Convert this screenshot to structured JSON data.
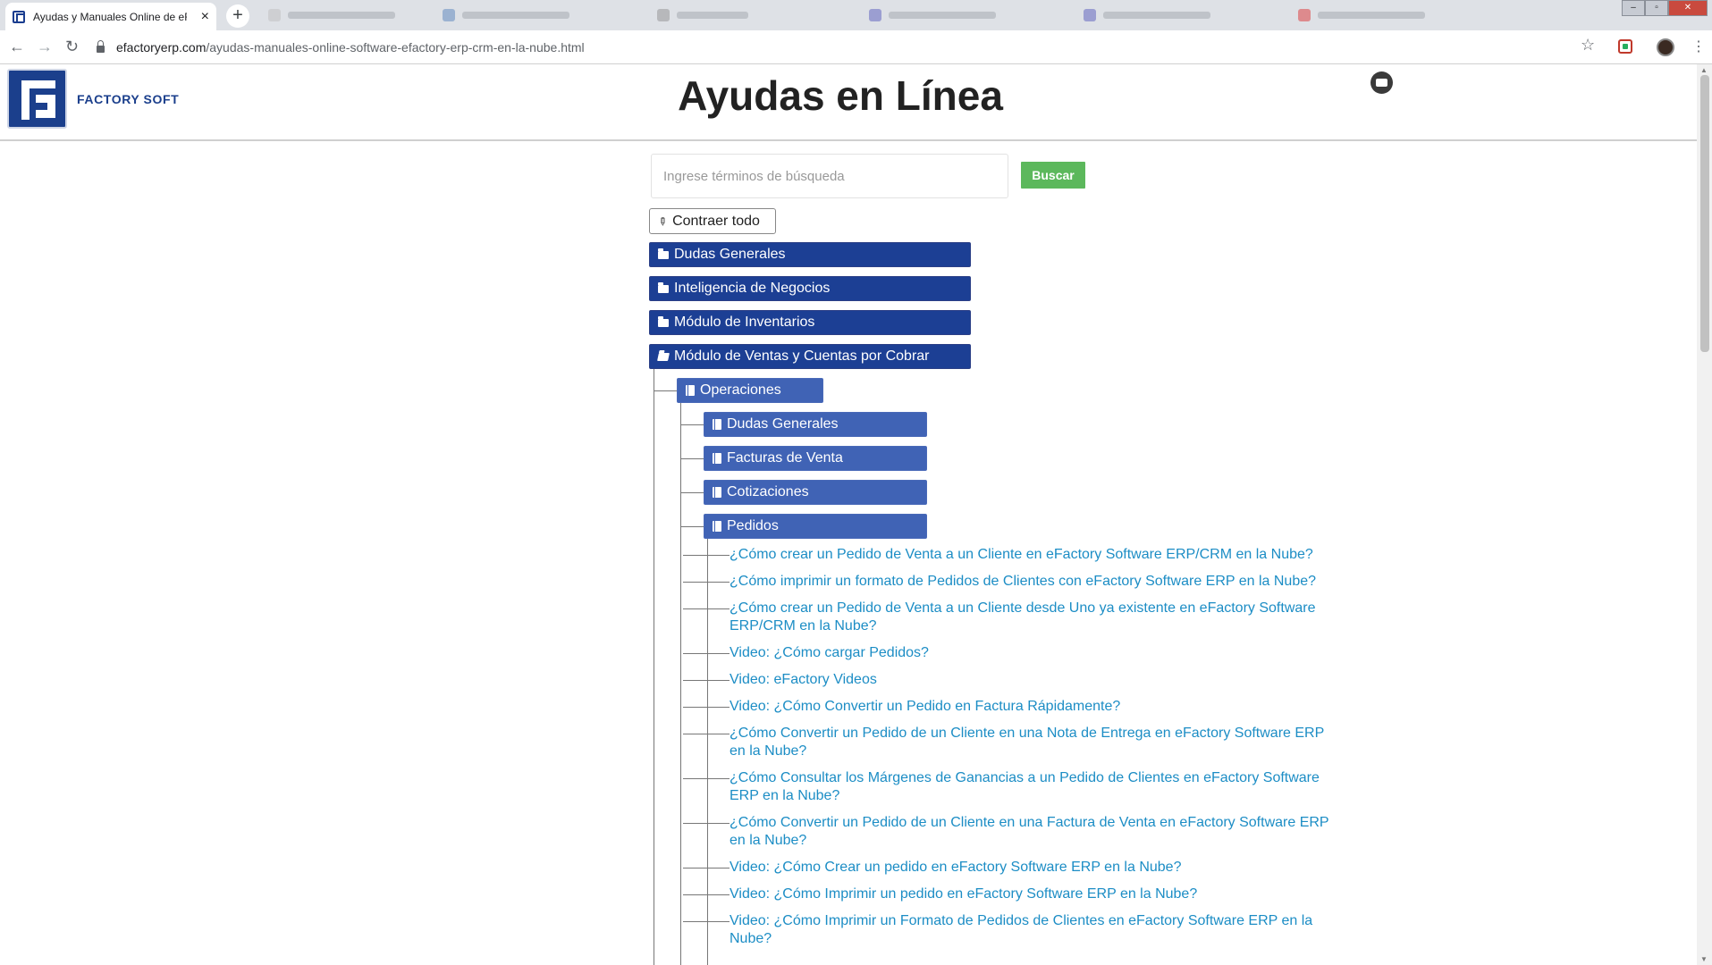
{
  "browser": {
    "active_tab_title": "Ayudas y Manuales Online de eF",
    "url_host": "efactoryerp.com",
    "url_path": "/ayudas-manuales-online-software-efactory-erp-crm-en-la-nube.html"
  },
  "header": {
    "brand": "FACTORY SOFT",
    "title": "Ayudas en Línea"
  },
  "search": {
    "placeholder": "Ingrese términos de búsqueda",
    "button_label": "Buscar"
  },
  "collapse_label": "Contraer todo",
  "tree": {
    "top_level": [
      {
        "label": "Dudas Generales"
      },
      {
        "label": "Inteligencia de Negocios"
      },
      {
        "label": "Módulo de Inventarios"
      },
      {
        "label": "Módulo de Ventas y Cuentas por Cobrar"
      }
    ],
    "operaciones": "Operaciones",
    "sub_items": [
      {
        "label": "Dudas Generales"
      },
      {
        "label": "Facturas de Venta"
      },
      {
        "label": "Cotizaciones"
      },
      {
        "label": "Pedidos"
      }
    ],
    "links": [
      "¿Cómo crear un Pedido de Venta a un Cliente en eFactory Software ERP/CRM en la Nube?",
      "¿Cómo imprimir un formato de Pedidos de Clientes con eFactory Software ERP en la Nube?",
      "¿Cómo crear un Pedido de Venta a un Cliente desde Uno ya existente en eFactory Software ERP/CRM en la Nube?",
      "Video: ¿Cómo cargar Pedidos?",
      "Video: eFactory Videos",
      "Video: ¿Cómo Convertir un Pedido en Factura Rápidamente?",
      "¿Cómo Convertir un Pedido de un Cliente en una Nota de Entrega en eFactory Software ERP en la Nube?",
      "¿Cómo Consultar los Márgenes de Ganancias a un Pedido de Clientes en eFactory Software ERP en la Nube?",
      "¿Cómo Convertir un Pedido de un Cliente en una Factura de Venta en eFactory Software ERP en la Nube?",
      "Video: ¿Cómo Crear un pedido en eFactory Software ERP en la Nube?",
      "Video: ¿Cómo Imprimir un pedido en eFactory Software ERP en la Nube?",
      "Video: ¿Cómo Imprimir un Formato de Pedidos de Clientes en eFactory Software ERP en la Nube?"
    ]
  }
}
